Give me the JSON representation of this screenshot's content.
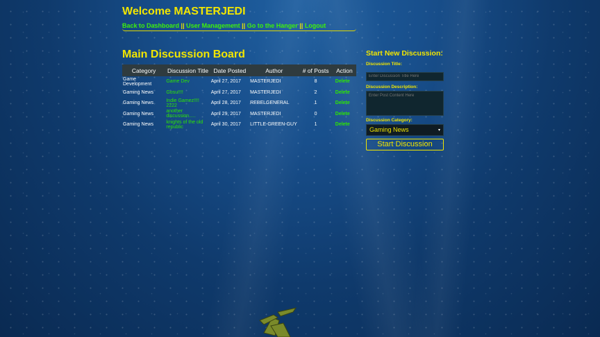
{
  "header": {
    "welcome": "Welcome MASTERJEDI",
    "links": [
      "Back to Dashboard",
      "User Management",
      "Go to the Hanger",
      "Logout"
    ],
    "separator": "||"
  },
  "board": {
    "title": "Main Discussion Board",
    "columns": [
      "Category",
      "Discussion Title",
      "Date Posted",
      "Author",
      "# of Posts",
      "Action"
    ],
    "rows": [
      {
        "category": "Game Development",
        "title": "Game Dev",
        "date": "April 27, 2017",
        "author": "MASTERJEDI",
        "posts": "8",
        "action": "Delete"
      },
      {
        "category": "Gaming News",
        "title": "Gosu!!!!",
        "date": "April 27, 2017",
        "author": "MASTERJEDI",
        "posts": "2",
        "action": "Delete"
      },
      {
        "category": "Gaming News",
        "title": "Indie Gamez!!!! 2222",
        "date": "April 28, 2017",
        "author": "REBELGENERAL",
        "posts": "1",
        "action": "Delete"
      },
      {
        "category": "Gaming News",
        "title": "another discussion.....",
        "date": "April 29, 2017",
        "author": "MASTERJEDI",
        "posts": "0",
        "action": "Delete"
      },
      {
        "category": "Gaming News",
        "title": "knights of the old republic",
        "date": "April 30, 2017",
        "author": "LITTLE-GREEN-GUY",
        "posts": "1",
        "action": "Delete"
      }
    ]
  },
  "new_discussion": {
    "heading": "Start New Discussion:",
    "title_label": "Discussion Title:",
    "title_placeholder": "Enter Discussion Title Here",
    "desc_label": "Discussion Description:",
    "desc_placeholder": "Enter Post Content Here",
    "category_label": "Discussion Category:",
    "category_selected": "Gaming News",
    "submit_label": "Start Discussion"
  },
  "colors": {
    "accent_yellow": "#f2e600",
    "link_green": "#3df00b",
    "table_header": "#2f3b3f"
  },
  "icons": {
    "select_arrow": "caret-down-icon",
    "ship": "x-wing-icon"
  }
}
